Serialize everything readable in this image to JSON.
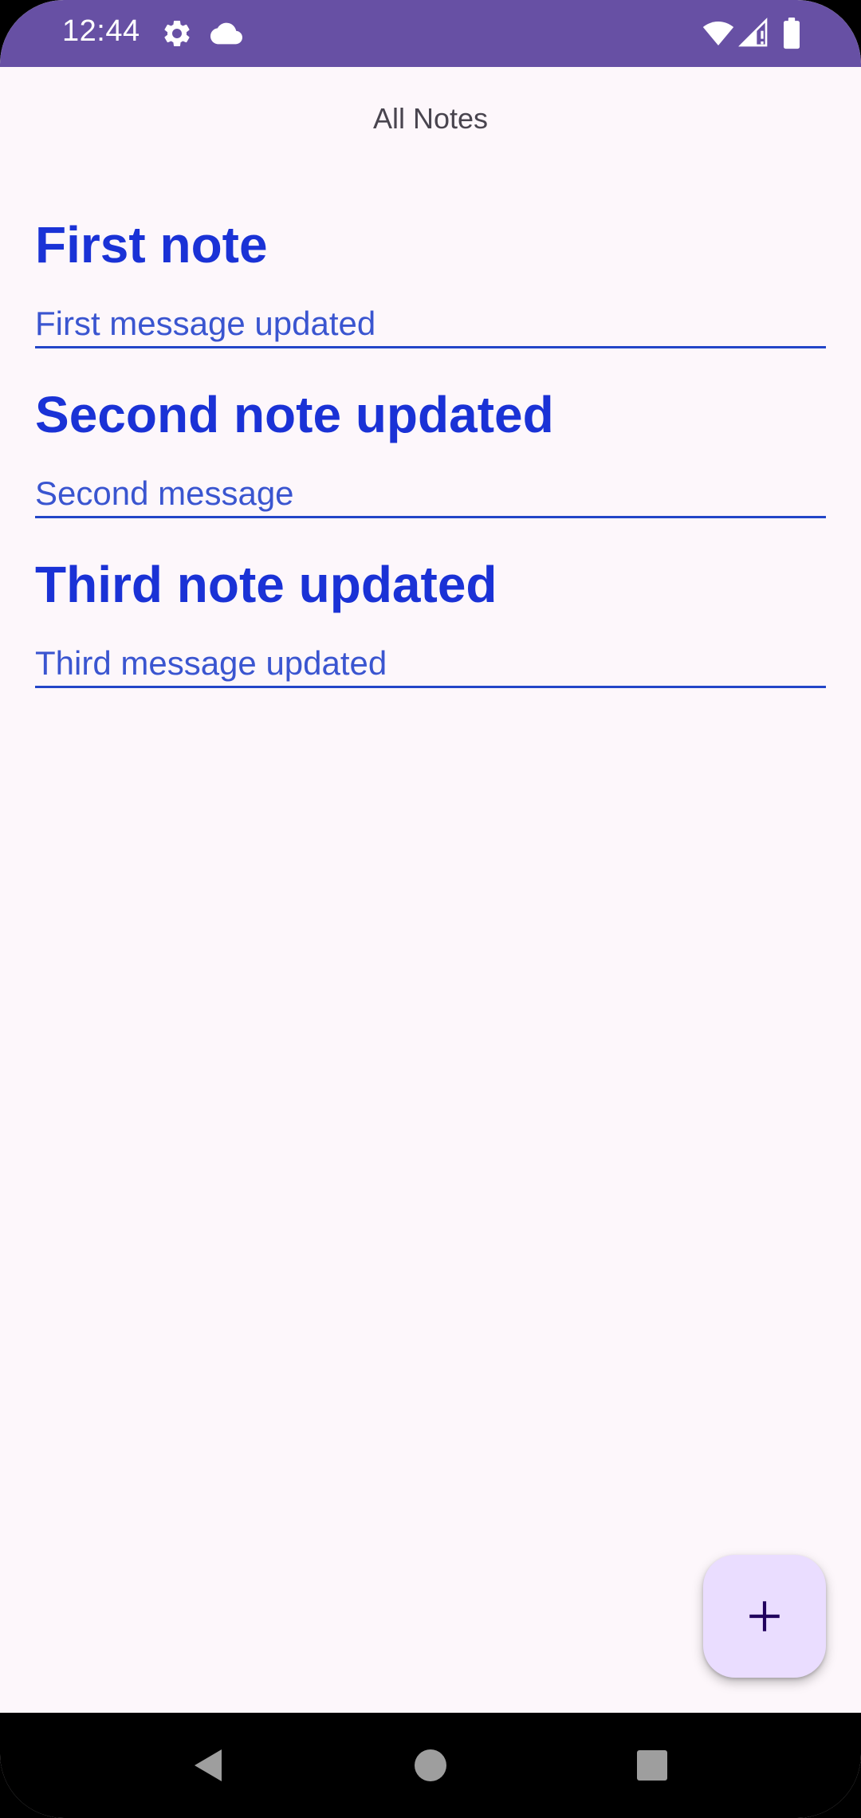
{
  "status_bar": {
    "time": "12:44",
    "icons": [
      "gear-icon",
      "cloud-icon",
      "wifi-icon",
      "signal-icon",
      "battery-icon"
    ],
    "color": "#6750a4"
  },
  "app": {
    "title": "All Notes"
  },
  "notes": [
    {
      "title": "First note",
      "message": "First message updated"
    },
    {
      "title": "Second note updated",
      "message": "Second message"
    },
    {
      "title": "Third note updated",
      "message": "Third message updated"
    }
  ],
  "fab": {
    "icon": "plus-icon",
    "color": "#eaddff"
  },
  "nav_bar": {
    "icons": [
      "back-icon",
      "home-icon",
      "recents-icon"
    ]
  },
  "colors": {
    "note_title": "#1a32d6",
    "note_message": "#3a55d0",
    "background": "#fdf7fb"
  }
}
